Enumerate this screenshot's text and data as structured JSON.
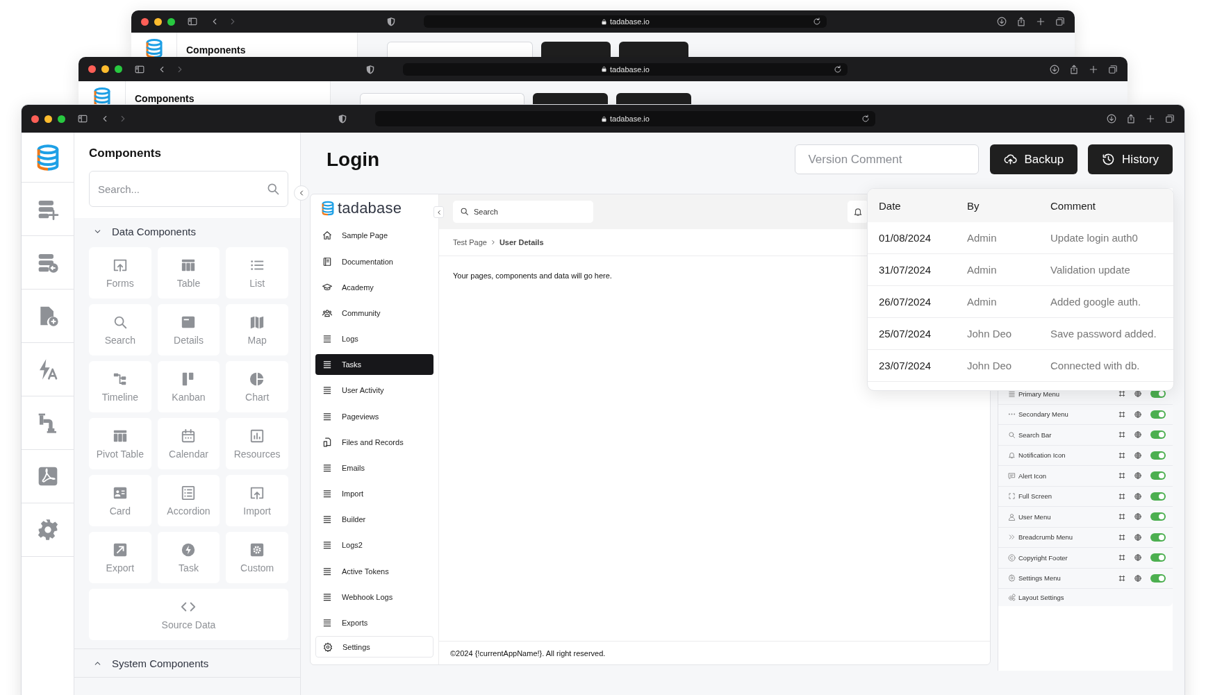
{
  "back_windows": [
    {
      "url": "tadabase.io",
      "sidebar_title": "Components"
    },
    {
      "url": "tadabase.io",
      "sidebar_title": "Components"
    }
  ],
  "browser": {
    "url": "tadabase.io"
  },
  "components": {
    "title": "Components",
    "search_placeholder": "Search...",
    "sections": [
      {
        "title": "Data Components",
        "expanded": true,
        "tiles": [
          "Forms",
          "Table",
          "List",
          "Search",
          "Details",
          "Map",
          "Timeline",
          "Kanban",
          "Chart",
          "Pivot Table",
          "Calendar",
          "Resources",
          "Card",
          "Accordion",
          "Import",
          "Export",
          "Task",
          "Custom",
          "Source Data"
        ]
      },
      {
        "title": "System Components",
        "expanded": false
      }
    ]
  },
  "page": {
    "title": "Login",
    "comment_placeholder": "Version Comment",
    "buttons": [
      "Backup",
      "History"
    ]
  },
  "preview": {
    "brand": "tadabase",
    "nav": [
      {
        "label": "Sample Page",
        "selected": false
      },
      {
        "label": "Documentation",
        "selected": false
      },
      {
        "label": "Academy",
        "selected": false
      },
      {
        "label": "Community",
        "selected": false
      },
      {
        "label": "Logs",
        "selected": false
      },
      {
        "label": "Tasks",
        "selected": true
      },
      {
        "label": "User Activity",
        "selected": false
      },
      {
        "label": "Pageviews",
        "selected": false
      },
      {
        "label": "Files and Records",
        "selected": false
      },
      {
        "label": "Emails",
        "selected": false
      },
      {
        "label": "Import",
        "selected": false
      },
      {
        "label": "Builder",
        "selected": false
      },
      {
        "label": "Logs2",
        "selected": false
      },
      {
        "label": "Active Tokens",
        "selected": false
      },
      {
        "label": "Webhook Logs",
        "selected": false
      },
      {
        "label": "Exports",
        "selected": false
      }
    ],
    "settings_item": "Settings",
    "search_placeholder": "Search",
    "alert": true,
    "breadcrumb": [
      "Test Page",
      "User Details"
    ],
    "body_text": "Your pages, components and data will go here.",
    "footer": "©2024 {!currentAppName!}. All right reserved."
  },
  "history": {
    "columns": [
      "Date",
      "By",
      "Comment"
    ],
    "rows": [
      [
        "01/08/2024",
        "Admin",
        "Update login auth0"
      ],
      [
        "31/07/2024",
        "Admin",
        "Validation update"
      ],
      [
        "26/07/2024",
        "Admin",
        "Added google auth."
      ],
      [
        "25/07/2024",
        "John Deo",
        "Save password added."
      ],
      [
        "23/07/2024",
        "John Deo",
        "Connected with db."
      ]
    ]
  },
  "layout_panel": {
    "items": [
      {
        "label": "Primary Menu",
        "on": true
      },
      {
        "label": "Secondary Menu",
        "on": true
      },
      {
        "label": "Search Bar",
        "on": true
      },
      {
        "label": "Notification Icon",
        "on": true
      },
      {
        "label": "Alert Icon",
        "on": true
      },
      {
        "label": "Full Screen",
        "on": true
      },
      {
        "label": "User Menu",
        "on": true
      },
      {
        "label": "Breadcrumb Menu",
        "on": true
      },
      {
        "label": "Copyright Footer",
        "on": true
      },
      {
        "label": "Settings Menu",
        "on": true
      }
    ],
    "footer": "Layout Settings"
  }
}
